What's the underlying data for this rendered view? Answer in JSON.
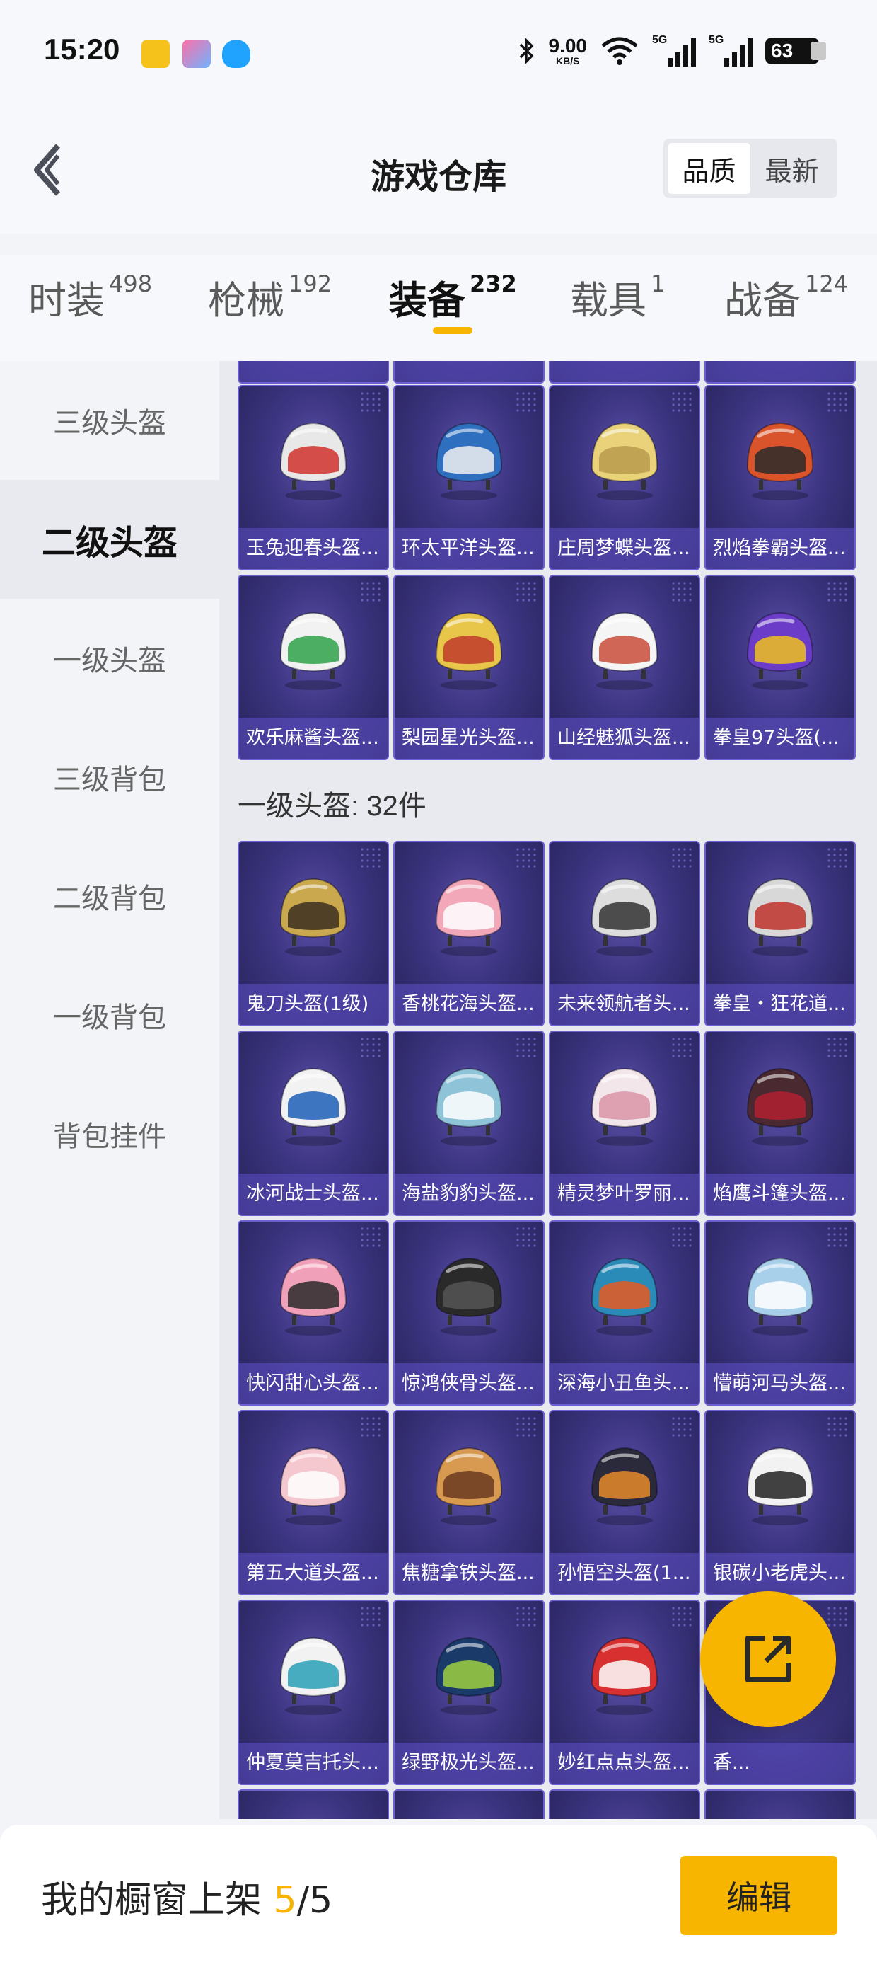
{
  "status_bar": {
    "time": "15:20",
    "net_speed_value": "9.00",
    "net_speed_unit": "KB/S",
    "signal_1_label": "5G",
    "signal_2_label": "5G",
    "battery": "63"
  },
  "header": {
    "title": "游戏仓库",
    "sort_options": [
      "品质",
      "最新"
    ],
    "sort_active": "品质"
  },
  "tabs": [
    {
      "label": "时装",
      "count": "498"
    },
    {
      "label": "枪械",
      "count": "192"
    },
    {
      "label": "装备",
      "count": "232"
    },
    {
      "label": "载具",
      "count": "1"
    },
    {
      "label": "战备",
      "count": "124"
    }
  ],
  "active_tab": "装备",
  "sidebar": {
    "items": [
      "三级头盔",
      "二级头盔",
      "一级头盔",
      "三级背包",
      "二级背包",
      "一级背包",
      "背包挂件"
    ],
    "active": "二级头盔"
  },
  "sections": {
    "level2": {
      "items": [
        "玉兔迎春头盔...",
        "环太平洋头盔...",
        "庄周梦蝶头盔...",
        "烈焰拳霸头盔...",
        "欢乐麻酱头盔...",
        "梨园星光头盔...",
        "山经魅狐头盔...",
        "拳皇97头盔(..."
      ]
    },
    "level1": {
      "title": "一级头盔: 32件",
      "items": [
        "鬼刀头盔(1级)",
        "香桃花海头盔...",
        "未来领航者头...",
        "拳皇・狂花道...",
        "冰河战士头盔...",
        "海盐豹豹头盔...",
        "精灵梦叶罗丽...",
        "焰鹰斗篷头盔...",
        "快闪甜心头盔...",
        "惊鸿侠骨头盔...",
        "深海小丑鱼头...",
        "懵萌河马头盔...",
        "第五大道头盔...",
        "焦糖拿铁头盔...",
        "孙悟空头盔(1...",
        "银碳小老虎头...",
        "仲夏莫吉托头...",
        "绿野极光头盔...",
        "妙红点点头盔...",
        "香..."
      ]
    }
  },
  "bottom_bar": {
    "label": "我的橱窗上架",
    "shown": "5",
    "total": "/5",
    "edit_label": "编辑"
  },
  "colors": {
    "accent": "#f7b500",
    "card_bg": "#3b3480",
    "card_label_bg": "#5f50c8"
  },
  "icons": [
    "back-arrow-icon",
    "bluetooth-icon",
    "wifi-icon",
    "signal-icon",
    "battery-icon",
    "share-external-icon"
  ]
}
